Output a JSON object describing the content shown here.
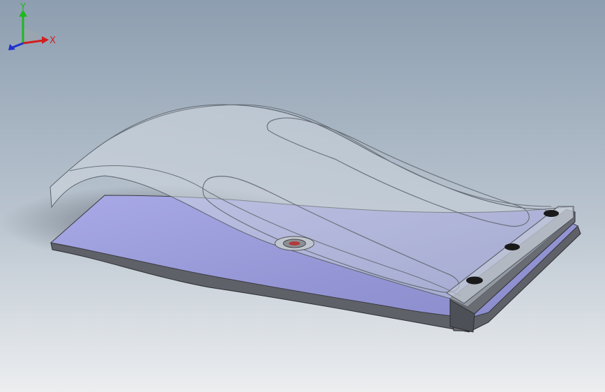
{
  "viewport": {
    "background_top": "#8d9eb0",
    "background_bottom": "#e9ecef"
  },
  "model": {
    "base_color": "#9a9bd8",
    "body_color": "#5c5f66",
    "shell_tint": "#c9d2dc",
    "bolt_color": "#1a1a1a",
    "center_hole_color": "#b23a3a"
  },
  "triad": {
    "x_label": "X",
    "y_label": "Y",
    "x_color": "#d11f1f",
    "y_color": "#1fb81f",
    "z_color": "#1f2fd1"
  }
}
